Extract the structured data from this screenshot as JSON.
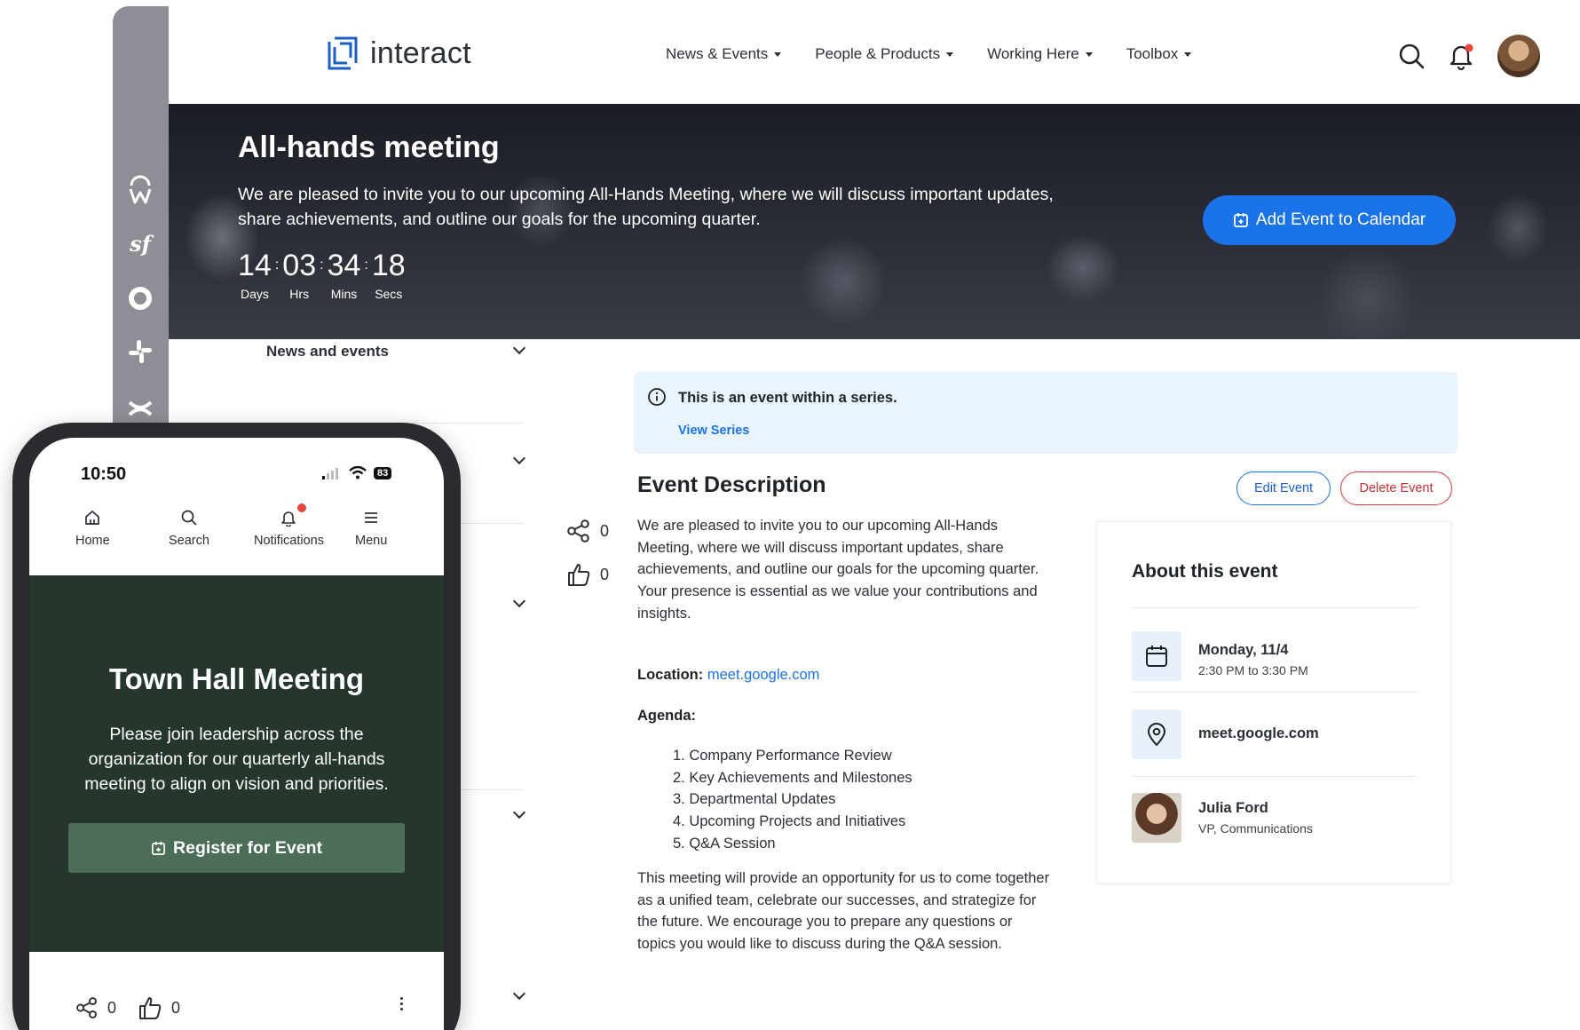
{
  "header": {
    "brand": "interact",
    "nav": [
      {
        "label": "News & Events"
      },
      {
        "label": "People & Products"
      },
      {
        "label": "Working Here"
      },
      {
        "label": "Toolbox"
      }
    ]
  },
  "hero": {
    "title": "All-hands meeting",
    "description": "We are pleased to invite you to our upcoming All-Hands Meeting, where we will discuss important updates, share achievements, and outline our goals for the upcoming quarter.",
    "countdown": [
      {
        "value": "14",
        "label": "Days"
      },
      {
        "value": "03",
        "label": "Hrs"
      },
      {
        "value": "34",
        "label": "Mins"
      },
      {
        "value": "18",
        "label": "Secs"
      }
    ],
    "calendar_button": "Add Event to Calendar"
  },
  "sidebar": {
    "first_label": "News and events"
  },
  "series_notice": {
    "text": "This is an event within a series.",
    "link": "View Series"
  },
  "social": {
    "shares": "0",
    "likes": "0"
  },
  "event": {
    "heading": "Event Description",
    "edit_button": "Edit Event",
    "delete_button": "Delete Event",
    "intro": "We are pleased to invite you to our upcoming All-Hands Meeting, where we will discuss important updates, share achievements, and outline our goals for the upcoming quarter. Your presence is essential as we value your contributions and insights.",
    "location_label": "Location:",
    "location_link": "meet.google.com",
    "agenda_label": "Agenda:",
    "agenda": [
      "1. Company Performance Review",
      "2. Key Achievements and Milestones",
      "3. Departmental Updates",
      "4. Upcoming Projects and Initiatives",
      "5. Q&A Session"
    ],
    "closing": "This meeting will provide an opportunity for us to come together as a unified team, celebrate our successes, and strategize for the future. We encourage you to prepare any questions or topics you would like to discuss during the Q&A session."
  },
  "about": {
    "title": "About this event",
    "date": "Monday, 11/4",
    "time": "2:30 PM to 3:30 PM",
    "location": "meet.google.com",
    "host_name": "Julia Ford",
    "host_role": "VP, Communications"
  },
  "phone": {
    "time": "10:50",
    "battery": "83",
    "tabs": [
      {
        "label": "Home"
      },
      {
        "label": "Search"
      },
      {
        "label": "Notifications"
      },
      {
        "label": "Menu"
      }
    ],
    "title": "Town Hall Meeting",
    "description": "Please join leadership across the organization for our quarterly all-hands meeting to align on vision and priorities.",
    "button": "Register for Event",
    "shares": "0",
    "likes": "0"
  },
  "colors": {
    "accent": "#1a73e8",
    "danger": "#d9383a",
    "phone_hero": "#25372d",
    "phone_button": "#4c6d57",
    "notice_bg": "#e9f4fd"
  }
}
